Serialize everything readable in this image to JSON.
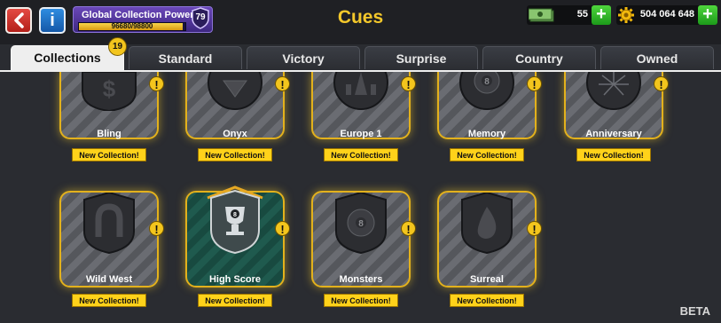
{
  "header": {
    "title": "Cues",
    "power": {
      "label": "Global Collection Power",
      "value": "96680/98800",
      "progress": 0.979,
      "level": "79"
    },
    "cash": {
      "amount": "55",
      "icon": "cash-icon"
    },
    "coins": {
      "amount": "504 064 648",
      "icon": "gear-coin-icon"
    },
    "plus": "+"
  },
  "tabs": [
    {
      "label": "Collections",
      "active": true,
      "badge": "19"
    },
    {
      "label": "Standard"
    },
    {
      "label": "Victory"
    },
    {
      "label": "Surprise"
    },
    {
      "label": "Country"
    },
    {
      "label": "Owned"
    }
  ],
  "collections": [
    {
      "name": "Bling",
      "ribbon": "New Collection!",
      "emblem": "dollar-icon"
    },
    {
      "name": "Onyx",
      "ribbon": "New Collection!",
      "emblem": "gem-icon"
    },
    {
      "name": "Europe 1",
      "ribbon": "New Collection!",
      "emblem": "landmark-icon"
    },
    {
      "name": "Memory",
      "ribbon": "New Collection!",
      "emblem": "eight-ball-laurel-icon"
    },
    {
      "name": "Anniversary",
      "ribbon": "New Collection!",
      "emblem": "firework-icon"
    },
    {
      "name": "Wild West",
      "ribbon": "New Collection!",
      "emblem": "horseshoe-icon"
    },
    {
      "name": "High Score",
      "ribbon": "New Collection!",
      "emblem": "trophy-icon"
    },
    {
      "name": "Monsters",
      "ribbon": "New Collection!",
      "emblem": "eight-ball-icon"
    },
    {
      "name": "Surreal",
      "ribbon": "New Collection!",
      "emblem": "drop-icon"
    }
  ],
  "warning_symbol": "!",
  "footer": {
    "beta": "BETA"
  },
  "colors": {
    "accent": "#f4c82b",
    "highlight": "#e3b11c",
    "panel": "#2a2c31"
  }
}
